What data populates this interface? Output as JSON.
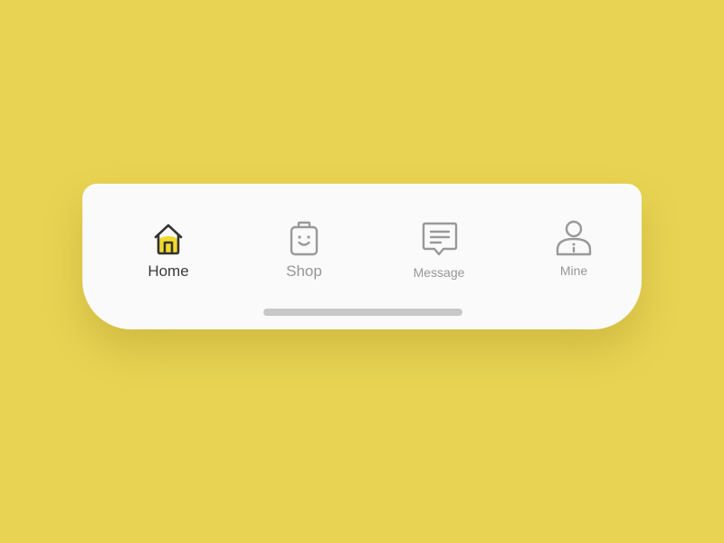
{
  "tabbar": {
    "tabs": [
      {
        "id": "home",
        "label": "Home",
        "icon": "house-icon",
        "active": true
      },
      {
        "id": "shop",
        "label": "Shop",
        "icon": "shopping-bag-icon",
        "active": false
      },
      {
        "id": "message",
        "label": "Message",
        "icon": "chat-bubble-icon",
        "active": false
      },
      {
        "id": "mine",
        "label": "Mine",
        "icon": "person-icon",
        "active": false
      }
    ]
  },
  "colors": {
    "background": "#E8D352",
    "accent": "#F2DA2E",
    "active_text": "#3A3A3A",
    "inactive": "#979797",
    "bar": "#FAFAFA",
    "home_indicator": "#C8C8C8"
  }
}
